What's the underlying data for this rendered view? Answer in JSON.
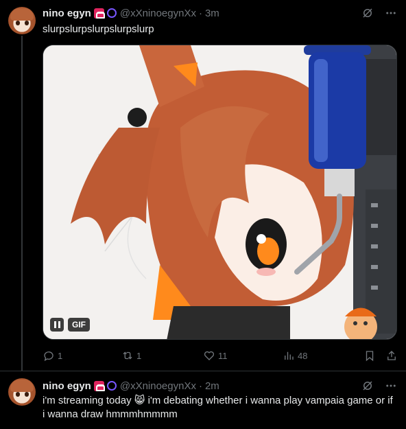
{
  "tweets": [
    {
      "display_name": "nino egyn",
      "handle": "@xXninoegynXx",
      "time": "3m",
      "text": "slurpslurpslurpslurpslurp",
      "media": {
        "type": "gif",
        "gif_label": "GIF"
      },
      "stats": {
        "replies": "1",
        "reposts": "1",
        "likes": "11",
        "views": "48"
      }
    },
    {
      "display_name": "nino egyn",
      "handle": "@xXninoegynXx",
      "time": "2m",
      "text_before_emoji": "i'm streaming today",
      "emoji": "😸",
      "text_after_emoji": "i'm debating whether i wanna play vampaia game or if i wanna draw hmmmhmmmm"
    }
  ],
  "separator": "·",
  "icons": {
    "grok": "grok-icon",
    "more": "more-icon",
    "reply": "reply-icon",
    "repost": "repost-icon",
    "like": "like-icon",
    "views": "views-icon",
    "bookmark": "bookmark-icon",
    "share": "share-icon"
  },
  "colors": {
    "background": "#000000",
    "text": "#e7e9ea",
    "muted": "#71767b",
    "badge_red": "#e0245e",
    "badge_purple": "#7856ff"
  }
}
